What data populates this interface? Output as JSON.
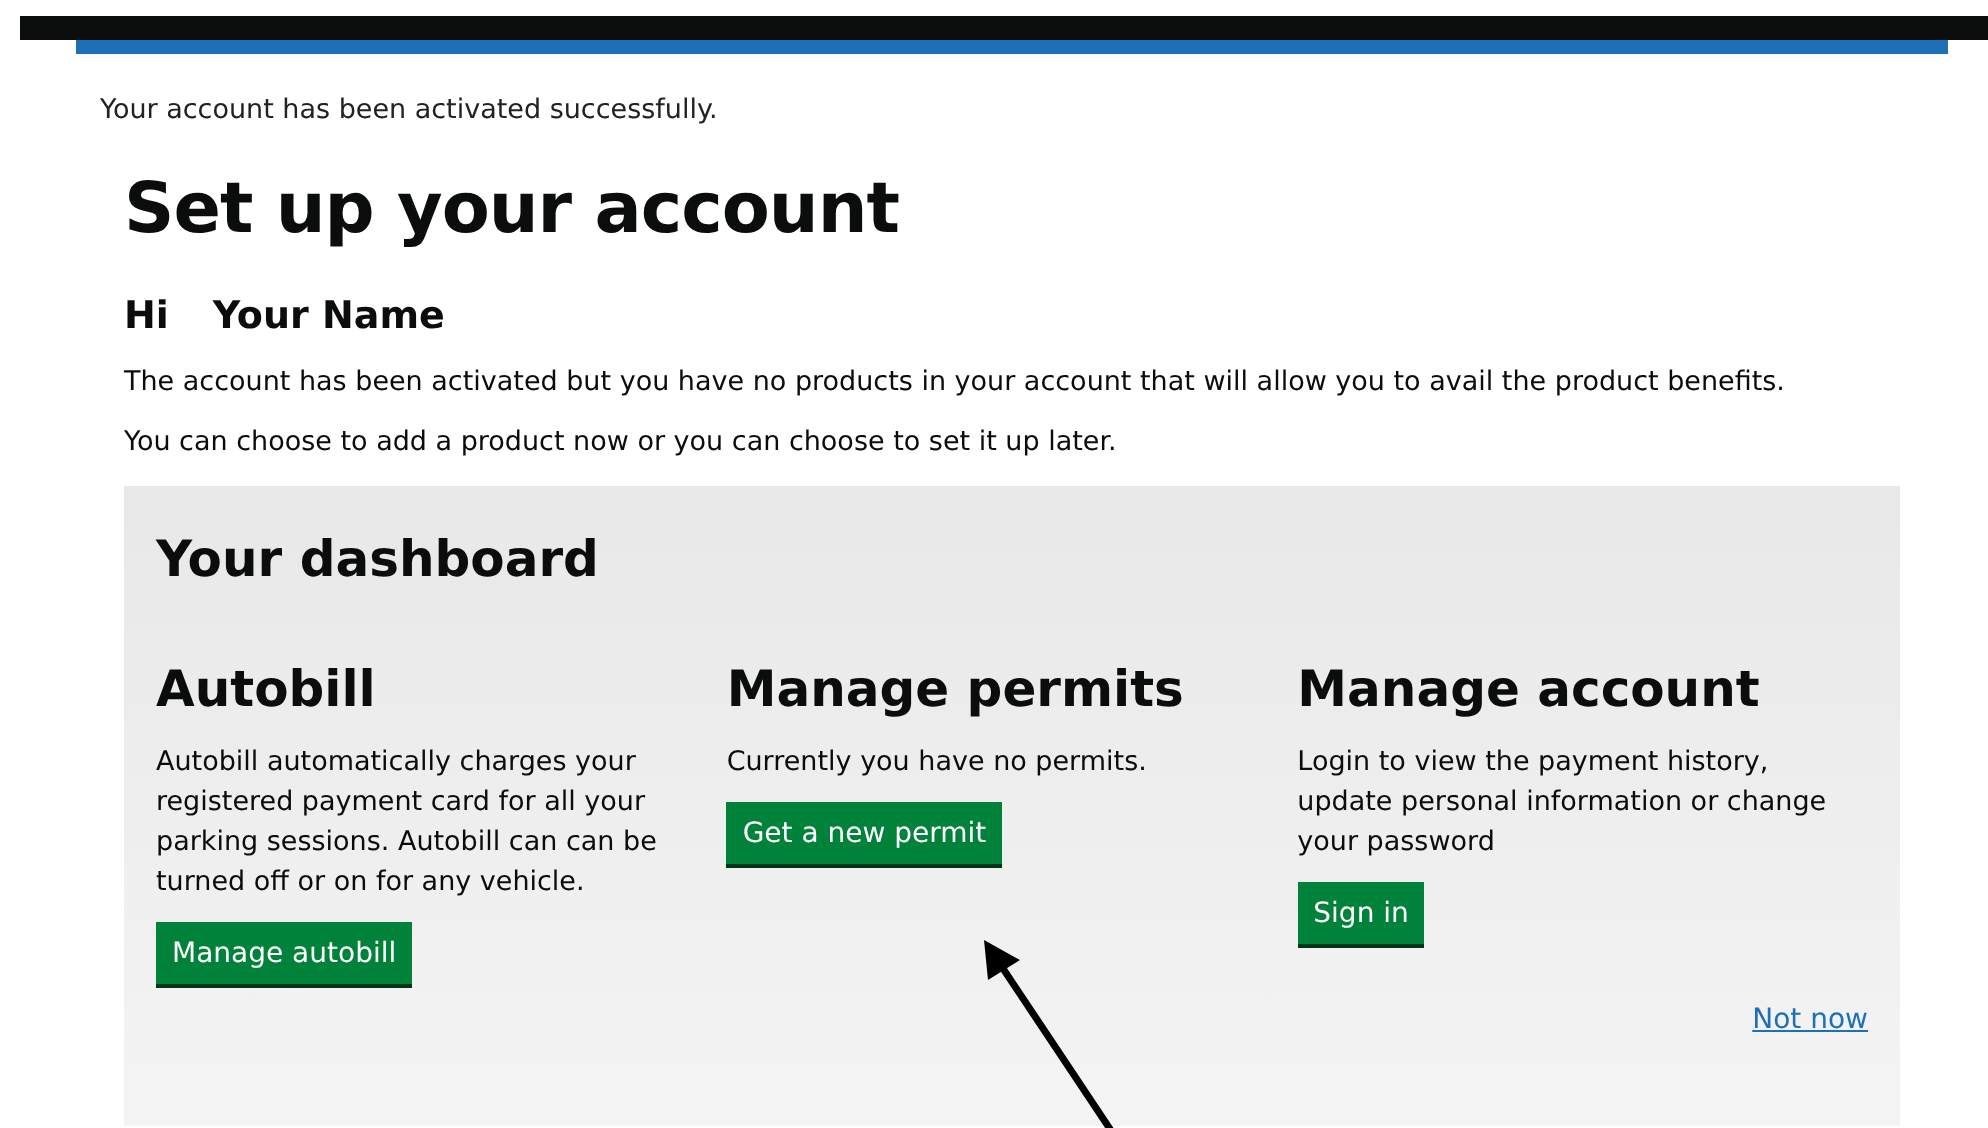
{
  "notice": "Your account has been activated successfully.",
  "title": "Set up your account",
  "greeting": {
    "prefix": "Hi",
    "name": "Your Name"
  },
  "paragraphs": [
    "The account has been activated but you have no products in your account that will allow you to avail the product benefits.",
    "You can choose to add a product now or you can choose to set it up later."
  ],
  "dashboard": {
    "title": "Your dashboard",
    "sections": [
      {
        "heading": "Autobill",
        "text": "Autobill automatically charges your registered payment card for all your parking sessions. Autobill can can be turned off or on for any vehicle.",
        "button": "Manage autobill"
      },
      {
        "heading": "Manage permits",
        "text": "Currently you have no permits.",
        "button": "Get a new permit"
      },
      {
        "heading": "Manage account",
        "text": "Login to view the payment history, update personal information or change your password",
        "button": "Sign in"
      }
    ],
    "link": "Not now"
  }
}
